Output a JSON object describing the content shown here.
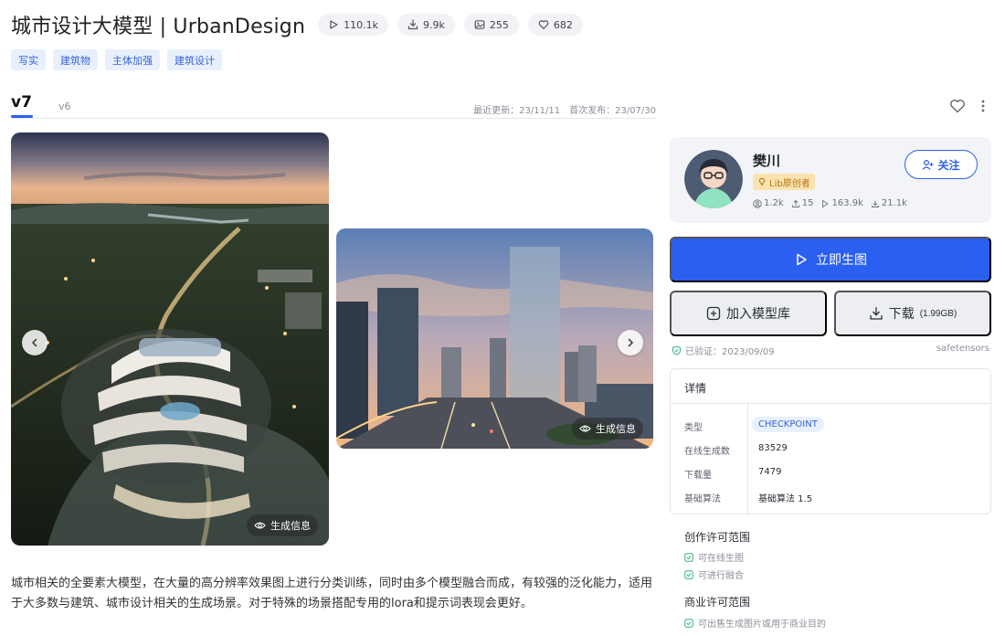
{
  "header": {
    "title": "城市设计大模型 | UrbanDesign",
    "stats": [
      {
        "icon": "play-icon",
        "value": "110.1k"
      },
      {
        "icon": "download-icon",
        "value": "9.9k"
      },
      {
        "icon": "image-icon",
        "value": "255"
      },
      {
        "icon": "heart-icon",
        "value": "682"
      }
    ]
  },
  "tags": [
    "写实",
    "建筑物",
    "主体加强",
    "建筑设计"
  ],
  "versions": {
    "active": "v7",
    "other": "v6",
    "updated": "最近更新：23/11/11",
    "published": "首次发布：23/07/30"
  },
  "gallery": {
    "gen_info_label": "生成信息"
  },
  "description": "城市相关的全要素大模型，在大量的高分辨率效果图上进行分类训练，同时由多个模型融合而成，有较强的泛化能力，适用于大多数与建筑、城市设计相关的生成场景。对于特殊的场景搭配专用的lora和提示词表现会更好。",
  "creator": {
    "name": "樊川",
    "badge": "Lib原创者",
    "stats": {
      "followers": "1.2k",
      "uploads": "15",
      "runs": "163.9k",
      "downloads": "21.1k"
    },
    "follow_label": "关注"
  },
  "actions": {
    "generate": "立即生图",
    "add_to_library": "加入模型库",
    "download": "下载",
    "download_size": "(1.99GB)"
  },
  "verification": {
    "text": "已验证：2023/09/09",
    "format": "safetensors"
  },
  "details": {
    "title": "详情",
    "rows": [
      {
        "key": "类型",
        "value": "CHECKPOINT"
      },
      {
        "key": "在线生成数",
        "value": "83529"
      },
      {
        "key": "下载量",
        "value": "7479"
      },
      {
        "key": "基础算法",
        "value": "基础算法 1.5"
      }
    ]
  },
  "licenses": {
    "creative_title": "创作许可范围",
    "creative_items": [
      "可在线生图",
      "可进行融合"
    ],
    "commercial_title": "商业许可范围",
    "commercial_items": [
      "可出售生成图片或用于商业目的"
    ]
  },
  "colors": {
    "accent": "#2b5ff0",
    "tag_bg": "#e8f0fd",
    "verified": "#36b37e"
  }
}
